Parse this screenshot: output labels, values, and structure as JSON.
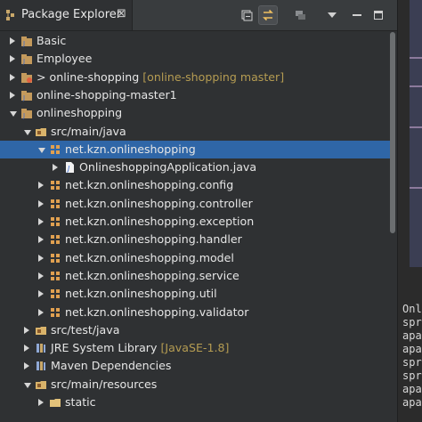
{
  "panel": {
    "title": "Package Explorer",
    "close_glyph": "⊠"
  },
  "toolbar": {
    "buttons": [
      {
        "name": "collapse-all-icon"
      },
      {
        "name": "link-with-editor-icon",
        "active": true
      },
      {
        "name": "focus-icon"
      },
      {
        "name": "view-menu-icon"
      },
      {
        "name": "minimize-icon"
      },
      {
        "name": "maximize-icon"
      }
    ]
  },
  "tree": [
    {
      "label": "Basic",
      "decoration": "",
      "twisty": "closed",
      "icon": "java-project-icon",
      "indent": 0
    },
    {
      "label": "Employee",
      "decoration": "",
      "twisty": "closed",
      "icon": "java-project-icon",
      "indent": 0
    },
    {
      "label": "> online-shopping",
      "decoration": "[online-shopping master]",
      "twisty": "closed",
      "icon": "git-project-icon",
      "indent": 0
    },
    {
      "label": "online-shopping-master1",
      "decoration": "",
      "twisty": "closed",
      "icon": "java-project-icon",
      "indent": 0
    },
    {
      "label": "onlineshopping",
      "decoration": "",
      "twisty": "open",
      "icon": "java-project-icon",
      "indent": 0
    },
    {
      "label": "src/main/java",
      "decoration": "",
      "twisty": "open",
      "icon": "source-folder-icon",
      "indent": 1
    },
    {
      "label": "net.kzn.onlineshopping",
      "decoration": "",
      "twisty": "open",
      "icon": "package-icon",
      "indent": 2,
      "selected": true
    },
    {
      "label": "OnlineshoppingApplication.java",
      "decoration": "",
      "twisty": "closed",
      "icon": "java-file-icon",
      "indent": 3
    },
    {
      "label": "net.kzn.onlineshopping.config",
      "decoration": "",
      "twisty": "closed",
      "icon": "package-icon",
      "indent": 2
    },
    {
      "label": "net.kzn.onlineshopping.controller",
      "decoration": "",
      "twisty": "closed",
      "icon": "package-icon",
      "indent": 2
    },
    {
      "label": "net.kzn.onlineshopping.exception",
      "decoration": "",
      "twisty": "closed",
      "icon": "package-icon",
      "indent": 2
    },
    {
      "label": "net.kzn.onlineshopping.handler",
      "decoration": "",
      "twisty": "closed",
      "icon": "package-icon",
      "indent": 2
    },
    {
      "label": "net.kzn.onlineshopping.model",
      "decoration": "",
      "twisty": "closed",
      "icon": "package-icon",
      "indent": 2
    },
    {
      "label": "net.kzn.onlineshopping.service",
      "decoration": "",
      "twisty": "closed",
      "icon": "package-icon",
      "indent": 2
    },
    {
      "label": "net.kzn.onlineshopping.util",
      "decoration": "",
      "twisty": "closed",
      "icon": "package-icon",
      "indent": 2
    },
    {
      "label": "net.kzn.onlineshopping.validator",
      "decoration": "",
      "twisty": "closed",
      "icon": "package-icon",
      "indent": 2
    },
    {
      "label": "src/test/java",
      "decoration": "",
      "twisty": "closed",
      "icon": "source-folder-icon",
      "indent": 1
    },
    {
      "label": "JRE System Library",
      "decoration": "[JavaSE-1.8]",
      "twisty": "closed",
      "icon": "library-icon",
      "indent": 1
    },
    {
      "label": "Maven Dependencies",
      "decoration": "",
      "twisty": "closed",
      "icon": "library-icon",
      "indent": 1
    },
    {
      "label": "src/main/resources",
      "decoration": "",
      "twisty": "open",
      "icon": "source-folder-icon",
      "indent": 1
    },
    {
      "label": "static",
      "decoration": "",
      "twisty": "closed",
      "icon": "folder-icon",
      "indent": 2
    }
  ],
  "right_panel": {
    "lines": [
      "Onl",
      "spr",
      "apa",
      "apa",
      "spr",
      "spr",
      "apa",
      "apa"
    ]
  },
  "colors": {
    "selection": "#2f66a7",
    "decoration": "#b59c52",
    "background": "#2f3133"
  }
}
